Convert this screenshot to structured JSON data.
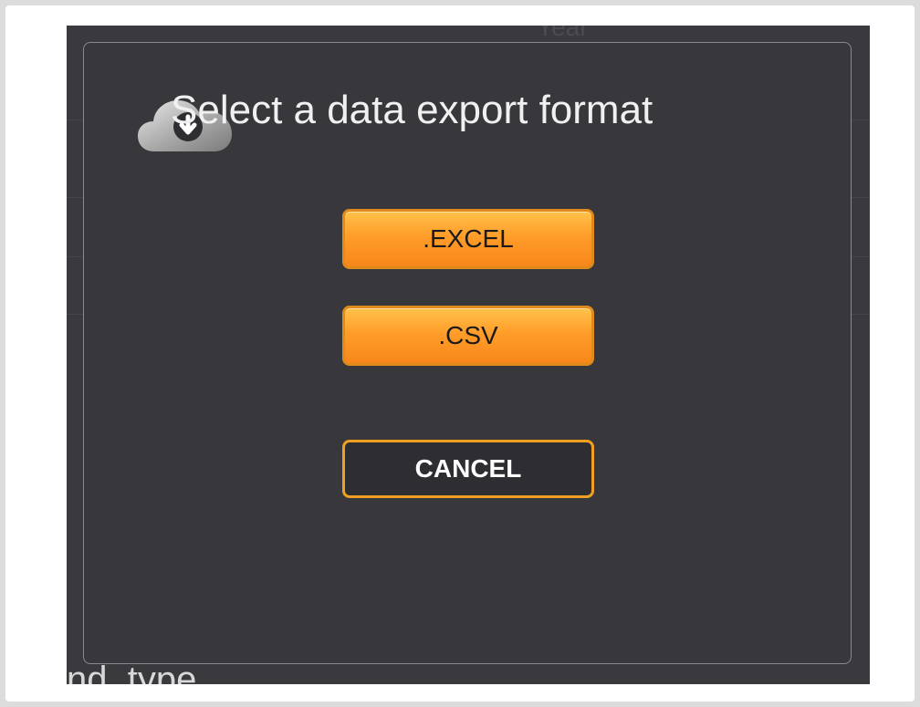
{
  "dialog": {
    "title": "Select a data export format",
    "icon": "cloud-download-icon",
    "buttons": {
      "excel_label": ".EXCEL",
      "csv_label": ".CSV",
      "cancel_label": "CANCEL"
    }
  },
  "background": {
    "column_header": "Year",
    "bottom_label": "nd_type"
  },
  "colors": {
    "accent": "#ff9d2a",
    "accent_border": "#f0a020",
    "modal_bg": "#38383c"
  }
}
